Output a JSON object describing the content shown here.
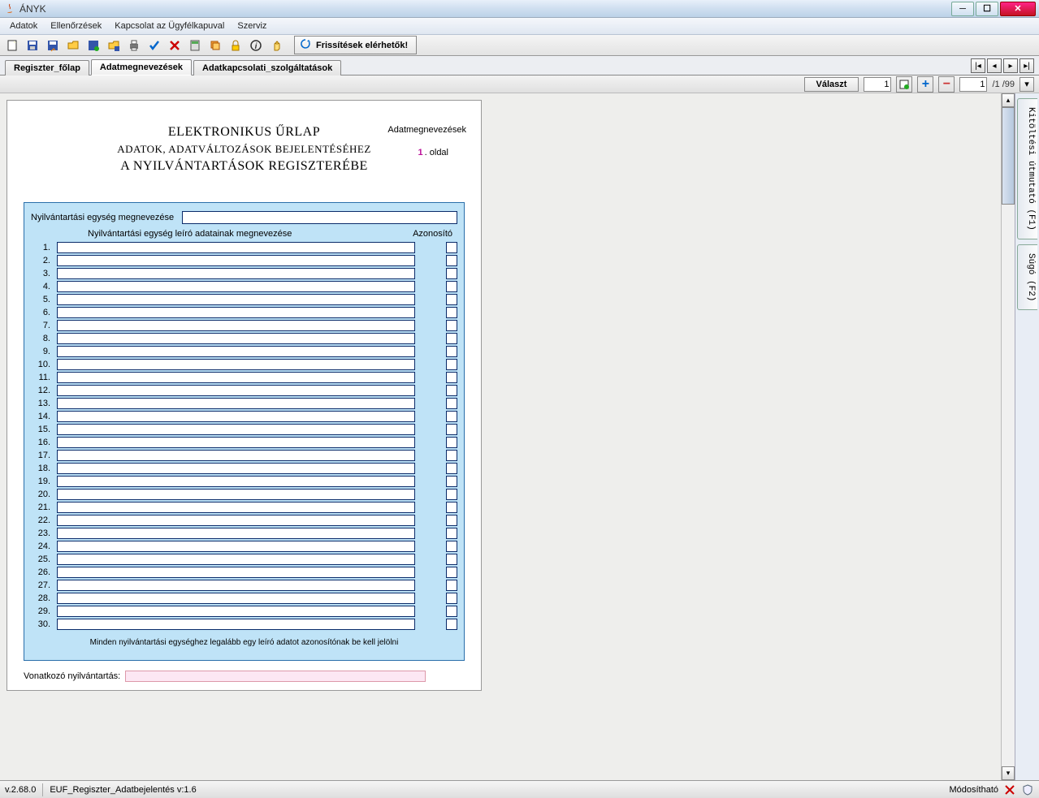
{
  "window": {
    "title": "ÁNYK"
  },
  "menubar": {
    "items": [
      "Adatok",
      "Ellenőrzések",
      "Kapcsolat az Ügyfélkapuval",
      "Szerviz"
    ]
  },
  "toolbar": {
    "update_label": "Frissítések elérhetők!"
  },
  "tabs": {
    "items": [
      {
        "label": "Regiszter_főlap"
      },
      {
        "label": "Adatmegnevezések"
      },
      {
        "label": "Adatkapcsolati_szolgáltatások"
      }
    ],
    "active_index": 1
  },
  "controlbar": {
    "valaszt_label": "Választ",
    "page_left_value": "1",
    "page_right_value": "1",
    "page_info": "/1 /99"
  },
  "form": {
    "header_line1": "ELEKTRONIKUS ŰRLAP",
    "header_line2": "ADATOK, ADATVÁLTOZÁSOK BEJELENTÉSÉHEZ",
    "header_line3": "A NYILVÁNTARTÁSOK REGISZTERÉBE",
    "top_right_label": "Adatmegnevezések",
    "page_number": "1",
    "page_suffix": ". oldal",
    "unit_name_label": "Nyilvántartási egység megnevezése",
    "unit_name_value": "",
    "col_header_left": "Nyilvántartási egység leíró adatainak megnevezése",
    "col_header_right": "Azonosító",
    "row_count": 30,
    "rows": [
      {
        "n": "1.",
        "val": ""
      },
      {
        "n": "2.",
        "val": ""
      },
      {
        "n": "3.",
        "val": ""
      },
      {
        "n": "4.",
        "val": ""
      },
      {
        "n": "5.",
        "val": ""
      },
      {
        "n": "6.",
        "val": ""
      },
      {
        "n": "7.",
        "val": ""
      },
      {
        "n": "8.",
        "val": ""
      },
      {
        "n": "9.",
        "val": ""
      },
      {
        "n": "10.",
        "val": ""
      },
      {
        "n": "11.",
        "val": ""
      },
      {
        "n": "12.",
        "val": ""
      },
      {
        "n": "13.",
        "val": ""
      },
      {
        "n": "14.",
        "val": ""
      },
      {
        "n": "15.",
        "val": ""
      },
      {
        "n": "16.",
        "val": ""
      },
      {
        "n": "17.",
        "val": ""
      },
      {
        "n": "18.",
        "val": ""
      },
      {
        "n": "19.",
        "val": ""
      },
      {
        "n": "20.",
        "val": ""
      },
      {
        "n": "21.",
        "val": ""
      },
      {
        "n": "22.",
        "val": ""
      },
      {
        "n": "23.",
        "val": ""
      },
      {
        "n": "24.",
        "val": ""
      },
      {
        "n": "25.",
        "val": ""
      },
      {
        "n": "26.",
        "val": ""
      },
      {
        "n": "27.",
        "val": ""
      },
      {
        "n": "28.",
        "val": ""
      },
      {
        "n": "29.",
        "val": ""
      },
      {
        "n": "30.",
        "val": ""
      }
    ],
    "footer_note": "Minden nyilvántartási egységhez legalább egy leíró adatot azonosítónak be kell jelölni",
    "vonatkozo_label": "Vonatkozó nyilvántartás:",
    "vonatkozo_value": ""
  },
  "right_tabs": {
    "items": [
      {
        "label": "Kitöltési útmutató (F1)"
      },
      {
        "label": "Súgó (F2)"
      }
    ]
  },
  "statusbar": {
    "version": "v.2.68.0",
    "doc_version": "EUF_Regiszter_Adatbejelentés v:1.6",
    "status_text": "Módosítható"
  }
}
